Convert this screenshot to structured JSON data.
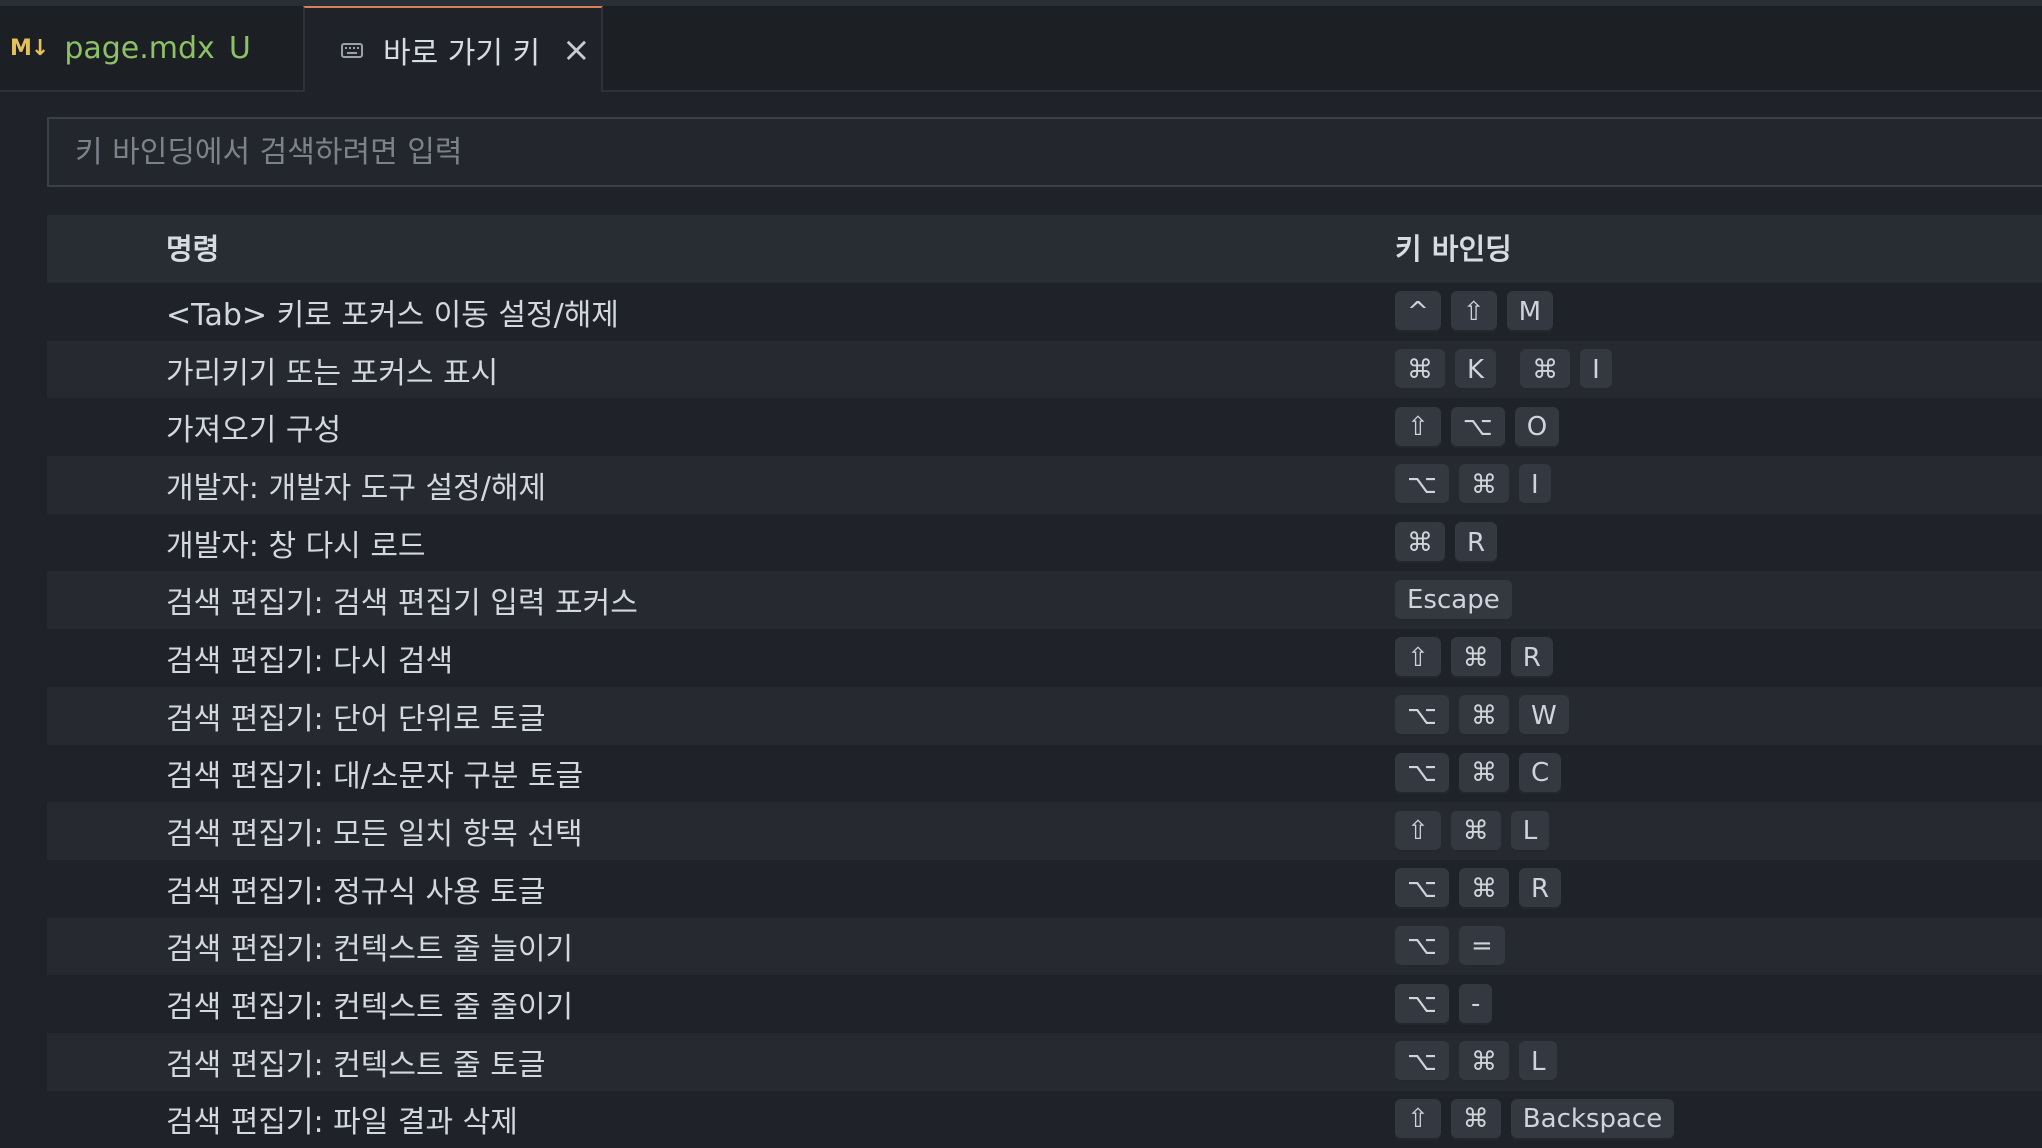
{
  "tabs": [
    {
      "icon": "markdown-icon",
      "icon_text": "M↓",
      "label": "page.mdx",
      "status": "U"
    },
    {
      "icon": "keyboard-icon",
      "label": "바로 가기 키",
      "close": "×"
    }
  ],
  "search": {
    "placeholder": "키 바인딩에서 검색하려면 입력"
  },
  "table": {
    "columns": {
      "command": "명령",
      "keybinding": "키 바인딩"
    },
    "rows": [
      {
        "command": "<Tab> 키로 포커스 이동 설정/해제",
        "keys": [
          [
            "^",
            "⇧",
            "M"
          ]
        ]
      },
      {
        "command": "가리키기 또는 포커스 표시",
        "keys": [
          [
            "⌘",
            "K"
          ],
          [
            "⌘",
            "I"
          ]
        ]
      },
      {
        "command": "가져오기 구성",
        "keys": [
          [
            "⇧",
            "⌥",
            "O"
          ]
        ]
      },
      {
        "command": "개발자: 개발자 도구 설정/해제",
        "keys": [
          [
            "⌥",
            "⌘",
            "I"
          ]
        ]
      },
      {
        "command": "개발자: 창 다시 로드",
        "keys": [
          [
            "⌘",
            "R"
          ]
        ]
      },
      {
        "command": "검색 편집기: 검색 편집기 입력 포커스",
        "keys": [
          [
            "Escape"
          ]
        ]
      },
      {
        "command": "검색 편집기: 다시 검색",
        "keys": [
          [
            "⇧",
            "⌘",
            "R"
          ]
        ]
      },
      {
        "command": "검색 편집기: 단어 단위로 토글",
        "keys": [
          [
            "⌥",
            "⌘",
            "W"
          ]
        ]
      },
      {
        "command": "검색 편집기: 대/소문자 구분 토글",
        "keys": [
          [
            "⌥",
            "⌘",
            "C"
          ]
        ]
      },
      {
        "command": "검색 편집기: 모든 일치 항목 선택",
        "keys": [
          [
            "⇧",
            "⌘",
            "L"
          ]
        ]
      },
      {
        "command": "검색 편집기: 정규식 사용 토글",
        "keys": [
          [
            "⌥",
            "⌘",
            "R"
          ]
        ]
      },
      {
        "command": "검색 편집기: 컨텍스트 줄 늘이기",
        "keys": [
          [
            "⌥",
            "="
          ]
        ]
      },
      {
        "command": "검색 편집기: 컨텍스트 줄 줄이기",
        "keys": [
          [
            "⌥",
            "-"
          ]
        ]
      },
      {
        "command": "검색 편집기: 컨텍스트 줄 토글",
        "keys": [
          [
            "⌥",
            "⌘",
            "L"
          ]
        ]
      },
      {
        "command": "검색 편집기: 파일 결과 삭제",
        "keys": [
          [
            "⇧",
            "⌘",
            "Backspace"
          ]
        ]
      }
    ]
  }
}
